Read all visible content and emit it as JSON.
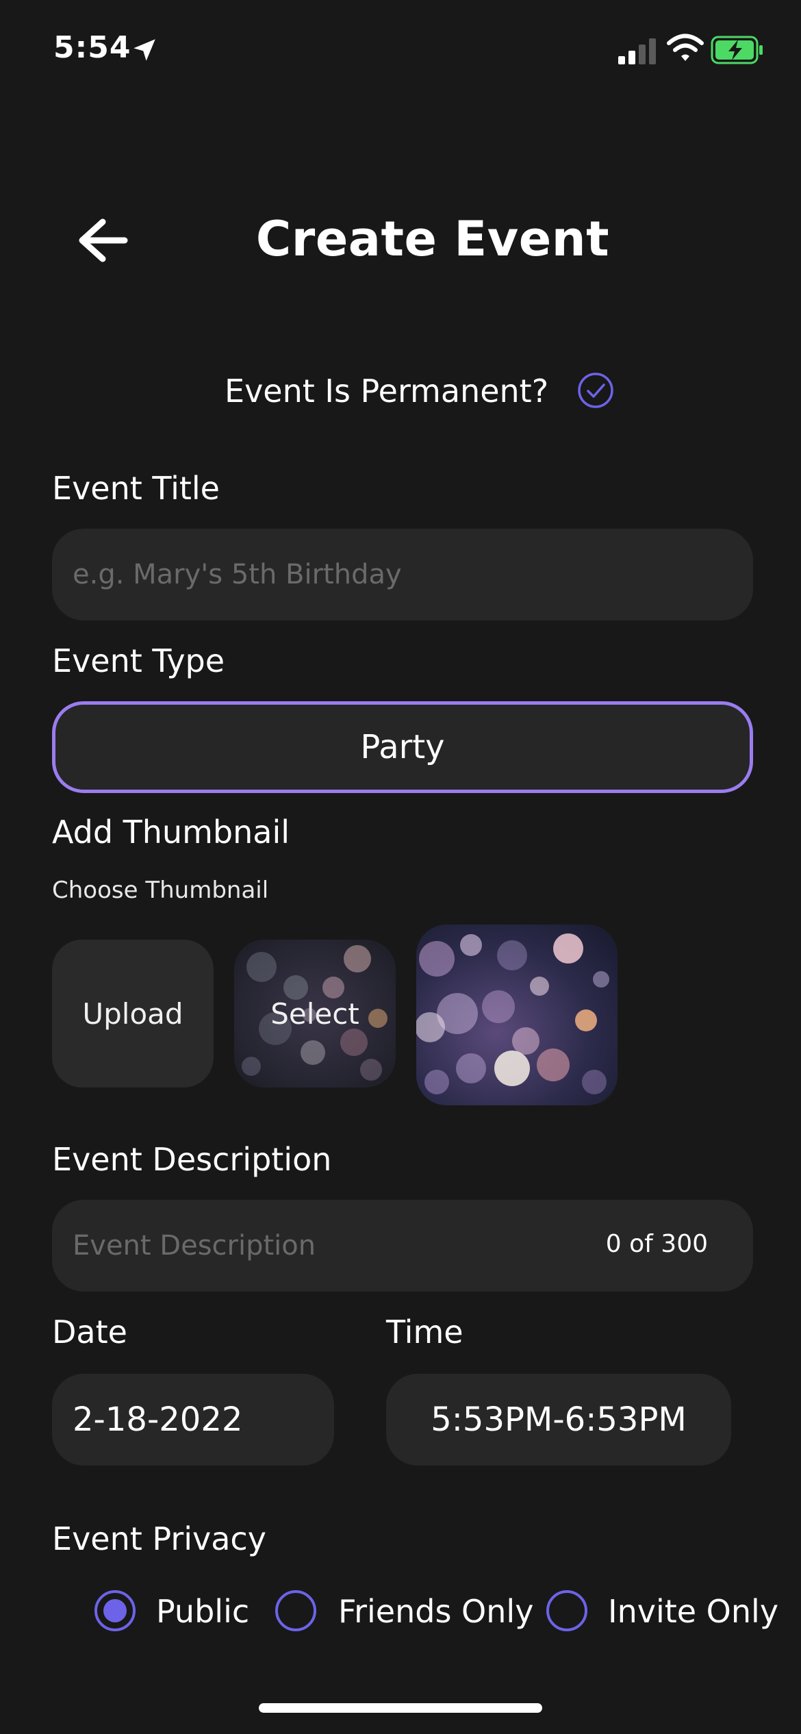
{
  "status_bar": {
    "time": "5:54",
    "icons": [
      "location-arrow-icon",
      "signal-icon",
      "wifi-icon",
      "battery-charging-icon"
    ],
    "battery_color": "#4cd964"
  },
  "header": {
    "back_icon": "arrow-left-icon",
    "title": "Create Event"
  },
  "permanent": {
    "label": "Event Is Permanent?",
    "checked": true,
    "accent": "#6d63e8"
  },
  "event_title": {
    "label": "Event Title",
    "value": "",
    "placeholder": "e.g. Mary's 5th Birthday"
  },
  "event_type": {
    "label": "Event Type",
    "value": "Party",
    "border_color": "#9b7cf0"
  },
  "thumbnail": {
    "label": "Add Thumbnail",
    "sublabel": "Choose Thumbnail",
    "upload_label": "Upload",
    "select_label": "Select"
  },
  "description": {
    "label": "Event Description",
    "value": "",
    "placeholder": "Event Description",
    "counter": "0 of 300"
  },
  "date": {
    "label": "Date",
    "value": "2-18-2022"
  },
  "time": {
    "label": "Time",
    "value": "5:53PM-6:53PM"
  },
  "privacy": {
    "label": "Event Privacy",
    "options": [
      {
        "label": "Public",
        "selected": true
      },
      {
        "label": "Friends Only",
        "selected": false
      },
      {
        "label": "Invite Only",
        "selected": false
      }
    ]
  }
}
